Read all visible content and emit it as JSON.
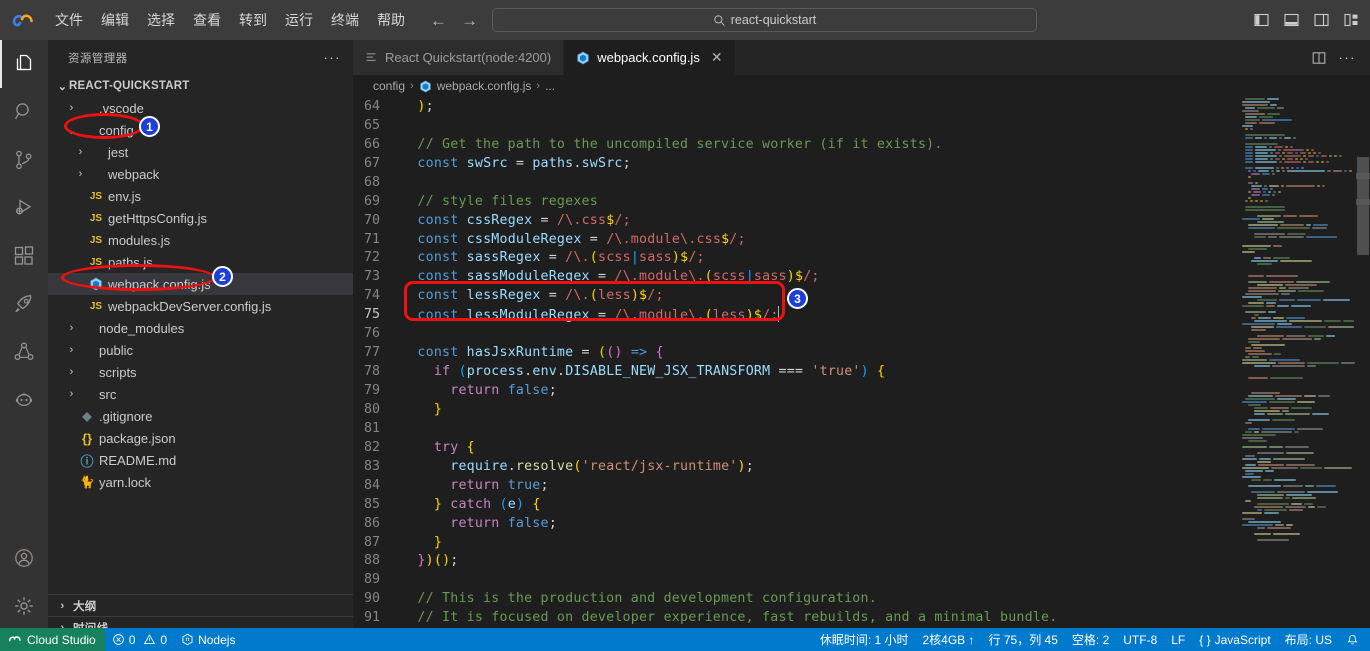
{
  "titlebar": {
    "logo_icon": "cloud-studio-logo",
    "menu": [
      {
        "label": "文件",
        "name": "menu-file"
      },
      {
        "label": "编辑",
        "name": "menu-edit"
      },
      {
        "label": "选择",
        "name": "menu-selection"
      },
      {
        "label": "查看",
        "name": "menu-view"
      },
      {
        "label": "转到",
        "name": "menu-go"
      },
      {
        "label": "运行",
        "name": "menu-run"
      },
      {
        "label": "终端",
        "name": "menu-terminal"
      },
      {
        "label": "帮助",
        "name": "menu-help"
      }
    ],
    "nav": {
      "back": "←",
      "forward": "→"
    },
    "search": {
      "value": "react-quickstart",
      "icon": "search-icon"
    },
    "window_actions": [
      {
        "name": "toggle-primary-sidebar-icon"
      },
      {
        "name": "toggle-panel-icon"
      },
      {
        "name": "toggle-secondary-sidebar-icon"
      },
      {
        "name": "customize-layout-icon"
      }
    ]
  },
  "activitybar": {
    "items": [
      {
        "name": "explorer-icon",
        "active": true
      },
      {
        "name": "search-icon",
        "active": false
      },
      {
        "name": "source-control-icon",
        "active": false
      },
      {
        "name": "run-and-debug-icon",
        "active": false
      },
      {
        "name": "extensions-icon",
        "active": false
      },
      {
        "name": "rocket-icon",
        "active": false
      },
      {
        "name": "share-icon",
        "active": false
      },
      {
        "name": "robot-icon",
        "active": false
      }
    ],
    "bottom": [
      {
        "name": "accounts-icon"
      },
      {
        "name": "settings-gear-icon"
      }
    ]
  },
  "sidebar": {
    "title": "资源管理器",
    "more_actions": "···",
    "root": "REACT-QUICKSTART",
    "tree": [
      {
        "label": ".vscode",
        "type": "folder",
        "indent": 1,
        "expanded": false
      },
      {
        "label": "config",
        "type": "folder",
        "indent": 1,
        "expanded": true
      },
      {
        "label": "jest",
        "type": "folder",
        "indent": 2,
        "expanded": false
      },
      {
        "label": "webpack",
        "type": "folder",
        "indent": 2,
        "expanded": false
      },
      {
        "label": "env.js",
        "type": "js",
        "indent": 2
      },
      {
        "label": "getHttpsConfig.js",
        "type": "js",
        "indent": 2
      },
      {
        "label": "modules.js",
        "type": "js",
        "indent": 2
      },
      {
        "label": "paths.js",
        "type": "js",
        "indent": 2
      },
      {
        "label": "webpack.config.js",
        "type": "webpack",
        "indent": 2,
        "selected": true
      },
      {
        "label": "webpackDevServer.config.js",
        "type": "js",
        "indent": 2
      },
      {
        "label": "node_modules",
        "type": "folder",
        "indent": 1,
        "expanded": false
      },
      {
        "label": "public",
        "type": "folder",
        "indent": 1,
        "expanded": false
      },
      {
        "label": "scripts",
        "type": "folder",
        "indent": 1,
        "expanded": false
      },
      {
        "label": "src",
        "type": "folder",
        "indent": 1,
        "expanded": false
      },
      {
        "label": ".gitignore",
        "type": "git",
        "indent": 1
      },
      {
        "label": "package.json",
        "type": "json",
        "indent": 1
      },
      {
        "label": "README.md",
        "type": "md",
        "indent": 1
      },
      {
        "label": "yarn.lock",
        "type": "lock",
        "indent": 1
      }
    ],
    "sections": [
      {
        "label": "大纲",
        "name": "outline-section"
      },
      {
        "label": "时间线",
        "name": "timeline-section"
      }
    ]
  },
  "editor": {
    "tabs": [
      {
        "label": "React Quickstart(node:4200)",
        "icon": "terminal-icon",
        "active": false,
        "closable": false
      },
      {
        "label": "webpack.config.js",
        "icon": "webpack-icon",
        "active": true,
        "closable": true,
        "close": "✕"
      }
    ],
    "tab_actions": [
      {
        "name": "split-editor-icon"
      },
      {
        "name": "more-actions-icon",
        "label": "···"
      }
    ],
    "breadcrumb": [
      "config",
      "webpack.config.js",
      "..."
    ],
    "first_line_number": 64,
    "lines": [
      {
        "n": 64,
        "tokens": [
          {
            "t": "  ",
            "c": "op"
          },
          {
            "t": ")",
            "c": "p1"
          },
          {
            "t": ";",
            "c": "op"
          }
        ]
      },
      {
        "n": 65,
        "tokens": []
      },
      {
        "n": 66,
        "tokens": [
          {
            "t": "  // Get the path to the uncompiled service worker (if it exists).",
            "c": "cmt"
          }
        ]
      },
      {
        "n": 67,
        "tokens": [
          {
            "t": "  ",
            "c": "op"
          },
          {
            "t": "const",
            "c": "kw"
          },
          {
            "t": " ",
            "c": "op"
          },
          {
            "t": "swSrc",
            "c": "var"
          },
          {
            "t": " = ",
            "c": "op"
          },
          {
            "t": "paths",
            "c": "var"
          },
          {
            "t": ".",
            "c": "op"
          },
          {
            "t": "swSrc",
            "c": "var"
          },
          {
            "t": ";",
            "c": "op"
          }
        ]
      },
      {
        "n": 68,
        "tokens": []
      },
      {
        "n": 69,
        "tokens": [
          {
            "t": "  // style files regexes",
            "c": "cmt"
          }
        ]
      },
      {
        "n": 70,
        "tokens": [
          {
            "t": "  ",
            "c": "op"
          },
          {
            "t": "const",
            "c": "kw"
          },
          {
            "t": " ",
            "c": "op"
          },
          {
            "t": "cssRegex",
            "c": "var"
          },
          {
            "t": " = ",
            "c": "op"
          },
          {
            "t": "/\\.css",
            "c": "rgx"
          },
          {
            "t": "$",
            "c": "p1"
          },
          {
            "t": "/;",
            "c": "rgx"
          }
        ]
      },
      {
        "n": 71,
        "tokens": [
          {
            "t": "  ",
            "c": "op"
          },
          {
            "t": "const",
            "c": "kw"
          },
          {
            "t": " ",
            "c": "op"
          },
          {
            "t": "cssModuleRegex",
            "c": "var"
          },
          {
            "t": " = ",
            "c": "op"
          },
          {
            "t": "/\\.module\\.css",
            "c": "rgx"
          },
          {
            "t": "$",
            "c": "p1"
          },
          {
            "t": "/;",
            "c": "rgx"
          }
        ]
      },
      {
        "n": 72,
        "tokens": [
          {
            "t": "  ",
            "c": "op"
          },
          {
            "t": "const",
            "c": "kw"
          },
          {
            "t": " ",
            "c": "op"
          },
          {
            "t": "sassRegex",
            "c": "var"
          },
          {
            "t": " = ",
            "c": "op"
          },
          {
            "t": "/\\.",
            "c": "rgx"
          },
          {
            "t": "(",
            "c": "p1"
          },
          {
            "t": "scss",
            "c": "rgx"
          },
          {
            "t": "|",
            "c": "p3"
          },
          {
            "t": "sass",
            "c": "rgx"
          },
          {
            "t": ")",
            "c": "p1"
          },
          {
            "t": "$",
            "c": "p1"
          },
          {
            "t": "/;",
            "c": "rgx"
          }
        ]
      },
      {
        "n": 73,
        "tokens": [
          {
            "t": "  ",
            "c": "op"
          },
          {
            "t": "const",
            "c": "kw"
          },
          {
            "t": " ",
            "c": "op"
          },
          {
            "t": "sassModuleRegex",
            "c": "var"
          },
          {
            "t": " = ",
            "c": "op"
          },
          {
            "t": "/\\.module\\.",
            "c": "rgx"
          },
          {
            "t": "(",
            "c": "p1"
          },
          {
            "t": "scss",
            "c": "rgx"
          },
          {
            "t": "|",
            "c": "p3"
          },
          {
            "t": "sass",
            "c": "rgx"
          },
          {
            "t": ")",
            "c": "p1"
          },
          {
            "t": "$",
            "c": "p1"
          },
          {
            "t": "/;",
            "c": "rgx"
          }
        ]
      },
      {
        "n": 74,
        "tokens": [
          {
            "t": "  ",
            "c": "op"
          },
          {
            "t": "const",
            "c": "kw"
          },
          {
            "t": " ",
            "c": "op"
          },
          {
            "t": "lessRegex",
            "c": "var"
          },
          {
            "t": " = ",
            "c": "op"
          },
          {
            "t": "/\\.",
            "c": "rgx"
          },
          {
            "t": "(",
            "c": "p1"
          },
          {
            "t": "less",
            "c": "rgx"
          },
          {
            "t": ")",
            "c": "p1"
          },
          {
            "t": "$",
            "c": "p1"
          },
          {
            "t": "/;",
            "c": "rgx"
          }
        ]
      },
      {
        "n": 75,
        "tokens": [
          {
            "t": "  ",
            "c": "op"
          },
          {
            "t": "const",
            "c": "kw"
          },
          {
            "t": " ",
            "c": "op"
          },
          {
            "t": "lessModuleRegex",
            "c": "var"
          },
          {
            "t": " = ",
            "c": "op"
          },
          {
            "t": "/\\.module\\.",
            "c": "rgx"
          },
          {
            "t": "(",
            "c": "p1"
          },
          {
            "t": "less",
            "c": "rgx"
          },
          {
            "t": ")",
            "c": "p1"
          },
          {
            "t": "$",
            "c": "p1"
          },
          {
            "t": "/;",
            "c": "rgx"
          }
        ],
        "cursor": true,
        "current": true
      },
      {
        "n": 76,
        "tokens": []
      },
      {
        "n": 77,
        "tokens": [
          {
            "t": "  ",
            "c": "op"
          },
          {
            "t": "const",
            "c": "kw"
          },
          {
            "t": " ",
            "c": "op"
          },
          {
            "t": "hasJsxRuntime",
            "c": "var"
          },
          {
            "t": " = ",
            "c": "op"
          },
          {
            "t": "(",
            "c": "p1"
          },
          {
            "t": "(",
            "c": "p2"
          },
          {
            "t": ")",
            "c": "p2"
          },
          {
            "t": " => ",
            "c": "kw"
          },
          {
            "t": "{",
            "c": "p2"
          }
        ]
      },
      {
        "n": 78,
        "tokens": [
          {
            "t": "    ",
            "c": "op"
          },
          {
            "t": "if",
            "c": "kw2"
          },
          {
            "t": " ",
            "c": "op"
          },
          {
            "t": "(",
            "c": "p3"
          },
          {
            "t": "process",
            "c": "var"
          },
          {
            "t": ".",
            "c": "op"
          },
          {
            "t": "env",
            "c": "var"
          },
          {
            "t": ".",
            "c": "op"
          },
          {
            "t": "DISABLE_NEW_JSX_TRANSFORM",
            "c": "var"
          },
          {
            "t": " === ",
            "c": "op"
          },
          {
            "t": "'true'",
            "c": "str"
          },
          {
            "t": ")",
            "c": "p3"
          },
          {
            "t": " ",
            "c": "op"
          },
          {
            "t": "{",
            "c": "p1"
          }
        ]
      },
      {
        "n": 79,
        "tokens": [
          {
            "t": "      ",
            "c": "op"
          },
          {
            "t": "return",
            "c": "kw2"
          },
          {
            "t": " ",
            "c": "op"
          },
          {
            "t": "false",
            "c": "kw"
          },
          {
            "t": ";",
            "c": "op"
          }
        ]
      },
      {
        "n": 80,
        "tokens": [
          {
            "t": "    ",
            "c": "op"
          },
          {
            "t": "}",
            "c": "p1"
          }
        ]
      },
      {
        "n": 81,
        "tokens": []
      },
      {
        "n": 82,
        "tokens": [
          {
            "t": "    ",
            "c": "op"
          },
          {
            "t": "try",
            "c": "kw2"
          },
          {
            "t": " ",
            "c": "op"
          },
          {
            "t": "{",
            "c": "p1"
          }
        ]
      },
      {
        "n": 83,
        "tokens": [
          {
            "t": "      ",
            "c": "op"
          },
          {
            "t": "require",
            "c": "var"
          },
          {
            "t": ".",
            "c": "op"
          },
          {
            "t": "resolve",
            "c": "fn"
          },
          {
            "t": "(",
            "c": "p1"
          },
          {
            "t": "'react/jsx-runtime'",
            "c": "str"
          },
          {
            "t": ")",
            "c": "p1"
          },
          {
            "t": ";",
            "c": "op"
          }
        ]
      },
      {
        "n": 84,
        "tokens": [
          {
            "t": "      ",
            "c": "op"
          },
          {
            "t": "return",
            "c": "kw2"
          },
          {
            "t": " ",
            "c": "op"
          },
          {
            "t": "true",
            "c": "kw"
          },
          {
            "t": ";",
            "c": "op"
          }
        ]
      },
      {
        "n": 85,
        "tokens": [
          {
            "t": "    ",
            "c": "op"
          },
          {
            "t": "}",
            "c": "p1"
          },
          {
            "t": " ",
            "c": "op"
          },
          {
            "t": "catch",
            "c": "kw2"
          },
          {
            "t": " ",
            "c": "op"
          },
          {
            "t": "(",
            "c": "p3"
          },
          {
            "t": "e",
            "c": "var"
          },
          {
            "t": ")",
            "c": "p3"
          },
          {
            "t": " ",
            "c": "op"
          },
          {
            "t": "{",
            "c": "p1"
          }
        ]
      },
      {
        "n": 86,
        "tokens": [
          {
            "t": "      ",
            "c": "op"
          },
          {
            "t": "return",
            "c": "kw2"
          },
          {
            "t": " ",
            "c": "op"
          },
          {
            "t": "false",
            "c": "kw"
          },
          {
            "t": ";",
            "c": "op"
          }
        ]
      },
      {
        "n": 87,
        "tokens": [
          {
            "t": "    ",
            "c": "op"
          },
          {
            "t": "}",
            "c": "p1"
          }
        ]
      },
      {
        "n": 88,
        "tokens": [
          {
            "t": "  ",
            "c": "op"
          },
          {
            "t": "}",
            "c": "p2"
          },
          {
            "t": ")",
            "c": "p1"
          },
          {
            "t": "(",
            "c": "p1"
          },
          {
            "t": ")",
            "c": "p1"
          },
          {
            "t": ";",
            "c": "op"
          }
        ]
      },
      {
        "n": 89,
        "tokens": []
      },
      {
        "n": 90,
        "tokens": [
          {
            "t": "  // This is the production and development configuration.",
            "c": "cmt"
          }
        ]
      },
      {
        "n": 91,
        "tokens": [
          {
            "t": "  // It is focused on developer experience, fast rebuilds, and a minimal bundle.",
            "c": "cmt"
          }
        ]
      }
    ]
  },
  "annotations": [
    {
      "badge": "1",
      "target": "config-folder-row"
    },
    {
      "badge": "2",
      "target": "webpack-config-js-row"
    },
    {
      "badge": "3",
      "target": "less-regex-code-lines"
    }
  ],
  "statusbar": {
    "cloud_studio": "Cloud Studio",
    "errors": "0",
    "warnings": "0",
    "runtime": "Nodejs",
    "right_items": [
      {
        "label": "休眠时间: 1 小时",
        "name": "status-hibernate-time"
      },
      {
        "label": "2核4GB ↑",
        "name": "status-spec"
      },
      {
        "label": "行 75，列 45",
        "name": "status-cursor-position"
      },
      {
        "label": "空格: 2",
        "name": "status-indentation"
      },
      {
        "label": "UTF-8",
        "name": "status-encoding"
      },
      {
        "label": "LF",
        "name": "status-eol"
      },
      {
        "label": "JavaScript",
        "name": "status-language-mode"
      },
      {
        "label": "布局: US",
        "name": "status-keyboard-layout"
      }
    ],
    "bell_icon": "notifications-bell-icon"
  },
  "colors": {
    "accent_blue": "#007acc",
    "cloud_green": "#16825d",
    "annotation_red": "#ee1111",
    "badge_blue": "#1b3fd8",
    "editor_bg": "#1e1e1e",
    "sidebar_bg": "#252526",
    "titlebar_bg": "#3c3c3c"
  }
}
